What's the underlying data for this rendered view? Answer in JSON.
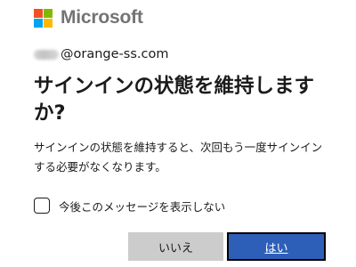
{
  "brand": {
    "name": "Microsoft",
    "logo_colors": [
      "#f25022",
      "#7fba00",
      "#00a4ef",
      "#ffb900"
    ]
  },
  "account": {
    "email_suffix": "@orange-ss.com"
  },
  "dialog": {
    "title": "サインインの状態を維持しますか?",
    "description": "サインインの状態を維持すると、次回もう一度サインインする必要がなくなります。",
    "checkbox_label": "今後このメッセージを表示しない",
    "checkbox_checked": false,
    "no_label": "いいえ",
    "yes_label": "はい"
  },
  "colors": {
    "primary": "#2e5fb8",
    "secondary": "#cccccc"
  }
}
